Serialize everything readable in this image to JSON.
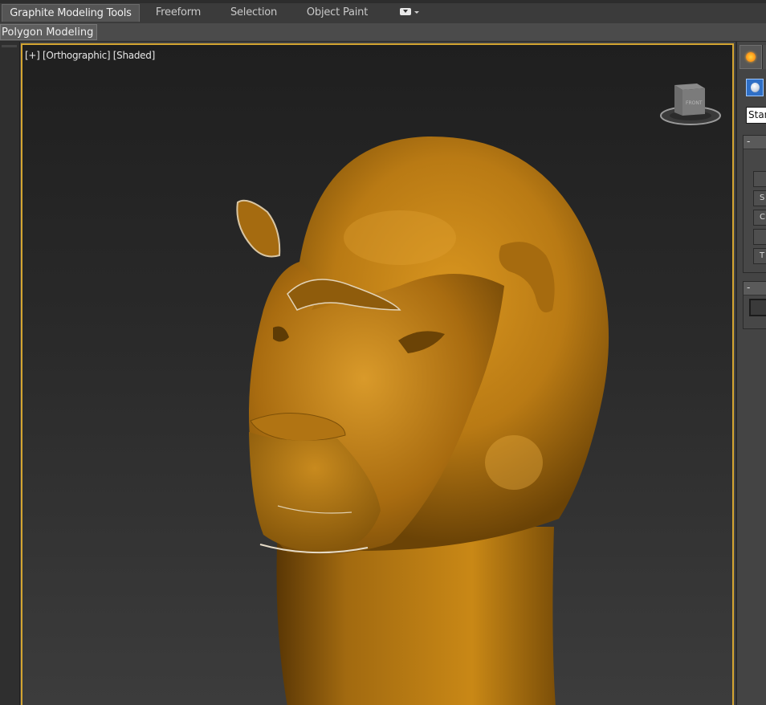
{
  "ribbon": {
    "tabs": [
      {
        "label": "Graphite Modeling Tools",
        "active": true
      },
      {
        "label": "Freeform",
        "active": false
      },
      {
        "label": "Selection",
        "active": false
      },
      {
        "label": "Object Paint",
        "active": false
      }
    ],
    "dropdown_icon": "ribbon-options-icon"
  },
  "panel": {
    "label": "Polygon Modeling"
  },
  "viewport": {
    "label": "[+] [Orthographic] [Shaded]",
    "active_border_color": "#d4a531",
    "model_color": "#b97a14",
    "viewcube_face_label": "FRONT"
  },
  "command_panel": {
    "create_tab_icon": "sun-light-icon",
    "geometry_icon": "sphere-geometry-icon",
    "category_dropdown": "Standard Primitives",
    "rollouts": [
      {
        "header": "-",
        "buttons": [
          "",
          "S",
          "C",
          "",
          "T"
        ]
      },
      {
        "header": "-"
      }
    ]
  }
}
